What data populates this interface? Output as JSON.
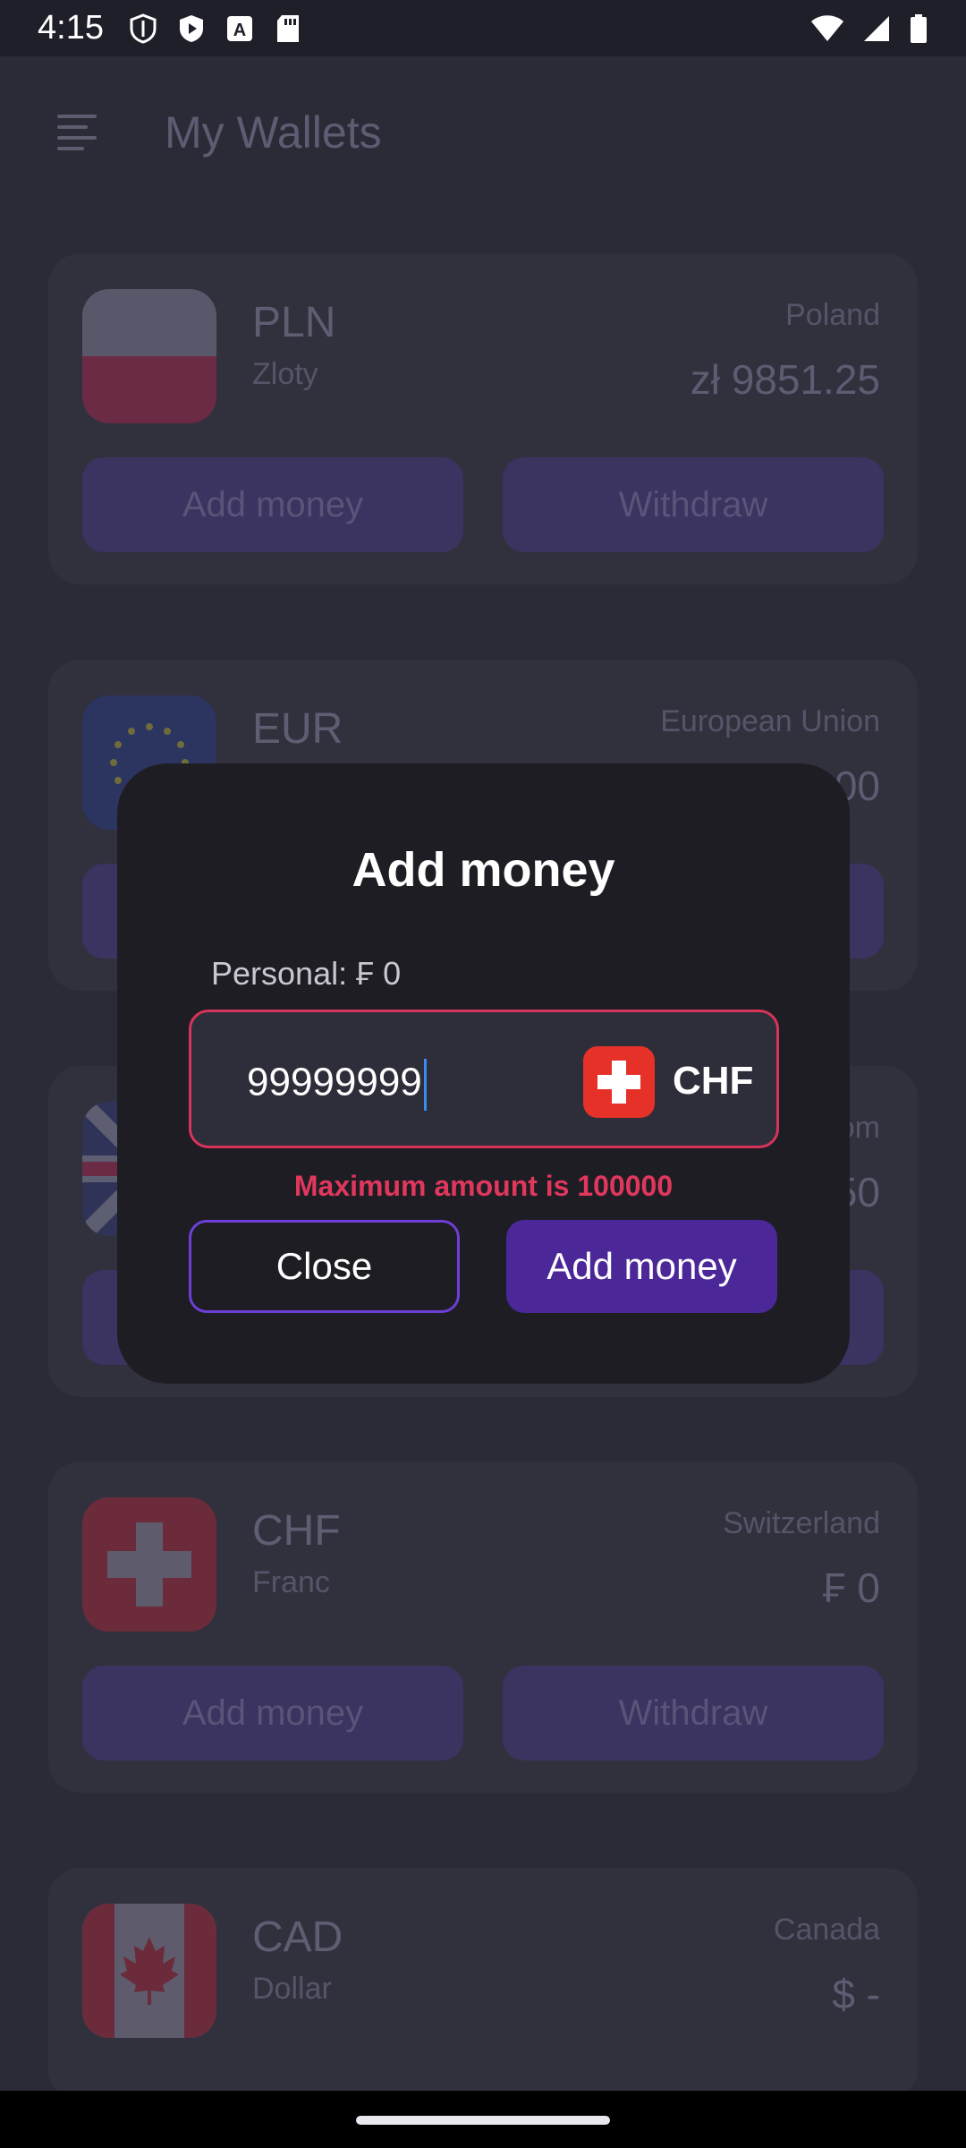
{
  "status_bar": {
    "time": "4:15",
    "left_icons": [
      "shield-icon",
      "play-protect-icon",
      "a-badge-icon",
      "sd-card-icon"
    ],
    "right_icons": [
      "wifi-icon",
      "signal-icon",
      "battery-icon"
    ]
  },
  "app_bar": {
    "title": "My Wallets",
    "menu_icon": "menu-icon"
  },
  "wallets": [
    {
      "code": "PLN",
      "name": "Zloty",
      "country": "Poland",
      "balance": "zł 9851.25",
      "add_label": "Add money",
      "withdraw_label": "Withdraw",
      "flag": "poland-flag"
    },
    {
      "code": "EUR",
      "name": "",
      "country": "European Union",
      "balance": "00",
      "add_label": "",
      "withdraw_label": "",
      "flag": "eu-flag"
    },
    {
      "code": "",
      "name": "",
      "country": "om",
      "balance": "50",
      "add_label": "",
      "withdraw_label": "",
      "flag": "uk-flag"
    },
    {
      "code": "CHF",
      "name": "Franc",
      "country": "Switzerland",
      "balance": "₣ 0",
      "add_label": "Add money",
      "withdraw_label": "Withdraw",
      "flag": "swiss-flag"
    },
    {
      "code": "CAD",
      "name": "Dollar",
      "country": "Canada",
      "balance": "$ -",
      "flag": "canada-flag"
    }
  ],
  "dialog": {
    "title": "Add money",
    "label": "Personal: ₣ 0",
    "amount_value": "99999999",
    "currency_code": "CHF",
    "error": "Maximum amount is 100000",
    "close_label": "Close",
    "add_label": "Add money",
    "error_color": "#e0375d",
    "accent_color": "#4b2798"
  }
}
